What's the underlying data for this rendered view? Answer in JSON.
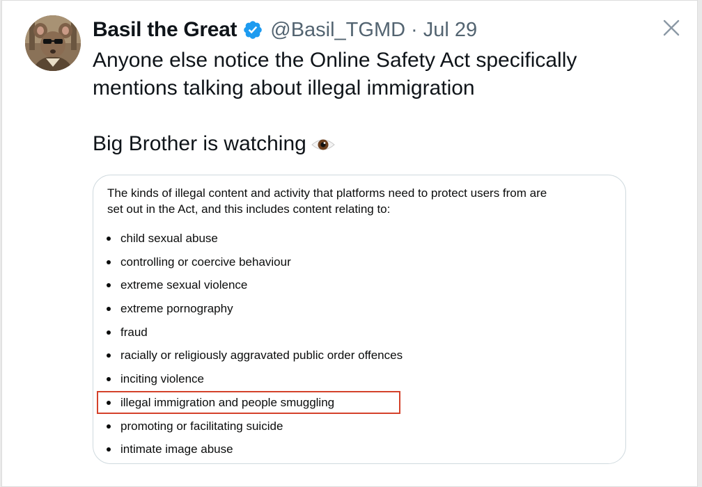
{
  "tweet": {
    "author_name": "Basil the Great",
    "handle": "@Basil_TGMD",
    "separator": "·",
    "date": "Jul 29",
    "verified_icon": "verified-badge-icon",
    "close_icon": "close-icon",
    "text_line_1": "Anyone else notice the Online Safety Act specifically mentions talking about illegal immigration",
    "text_line_2": "Big Brother is watching",
    "emoji": "eye-emoji-icon"
  },
  "document": {
    "intro_line_1": "The kinds of illegal content and activity that platforms need to protect users from are",
    "intro_line_2": "set out in the Act, and this includes content relating to:",
    "items": [
      "child sexual abuse",
      "controlling or coercive behaviour",
      "extreme sexual violence",
      "extreme pornography",
      "fraud",
      "racially or religiously aggravated public order offences",
      "inciting violence",
      "illegal immigration and people smuggling",
      "promoting or facilitating suicide",
      "intimate image abuse"
    ],
    "highlighted_item": "illegal immigration and people smuggling",
    "highlight_color": "#d4412a"
  },
  "colors": {
    "verified_blue": "#1d9bf0",
    "secondary_text": "#536471",
    "border": "#cfd9de"
  }
}
